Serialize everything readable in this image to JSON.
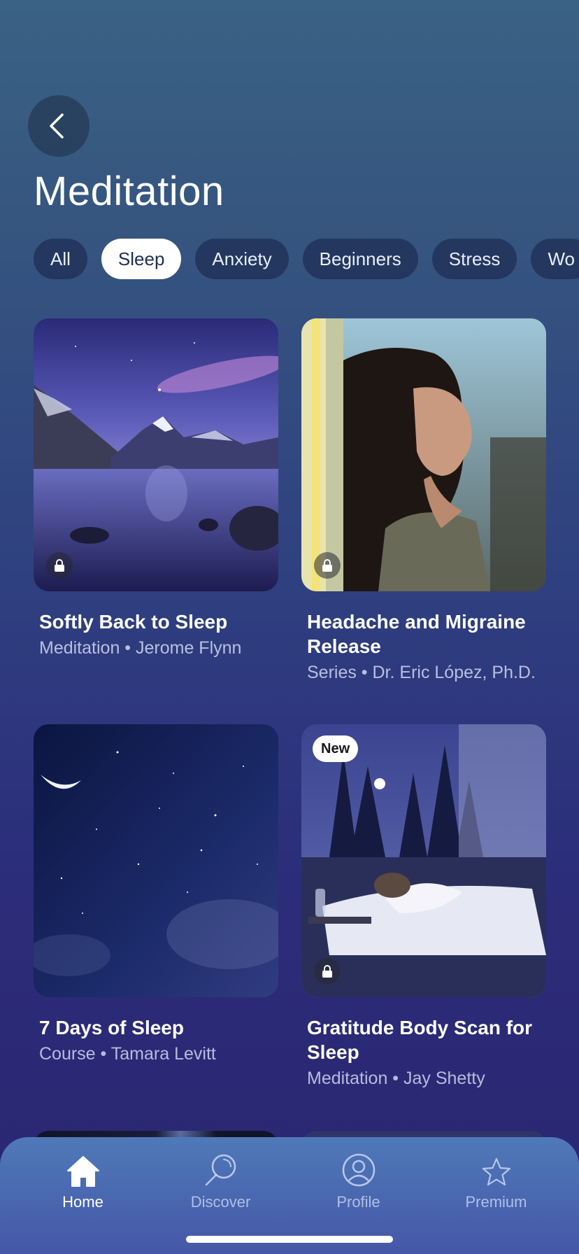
{
  "header": {
    "back_icon": "chevron-left-icon",
    "title": "Meditation"
  },
  "filters": {
    "selected": "Sleep",
    "chips": [
      "All",
      "Sleep",
      "Anxiety",
      "Beginners",
      "Stress",
      "Wo"
    ]
  },
  "cards": [
    {
      "title": "Softly Back to Sleep",
      "meta": "Meditation • Jerome Flynn",
      "locked": true,
      "badge": ""
    },
    {
      "title": "Headache and Migraine Release",
      "meta": "Series • Dr. Eric López, Ph.D.",
      "locked": true,
      "badge": ""
    },
    {
      "title": "7 Days of Sleep",
      "meta": "Course • Tamara Levitt",
      "locked": false,
      "badge": ""
    },
    {
      "title": "Gratitude Body Scan for Sleep",
      "meta": "Meditation • Jay Shetty",
      "locked": true,
      "badge": "New"
    }
  ],
  "tabbar": {
    "active": "Home",
    "tabs": [
      {
        "label": "Home",
        "icon": "home-icon"
      },
      {
        "label": "Discover",
        "icon": "search-icon"
      },
      {
        "label": "Profile",
        "icon": "profile-icon"
      },
      {
        "label": "Premium",
        "icon": "star-icon"
      }
    ]
  },
  "colors": {
    "background_top": "#3a6284",
    "background_bottom": "#2a2570",
    "chip_active_bg": "#ffffff",
    "tabbar": "#4a68b0"
  }
}
